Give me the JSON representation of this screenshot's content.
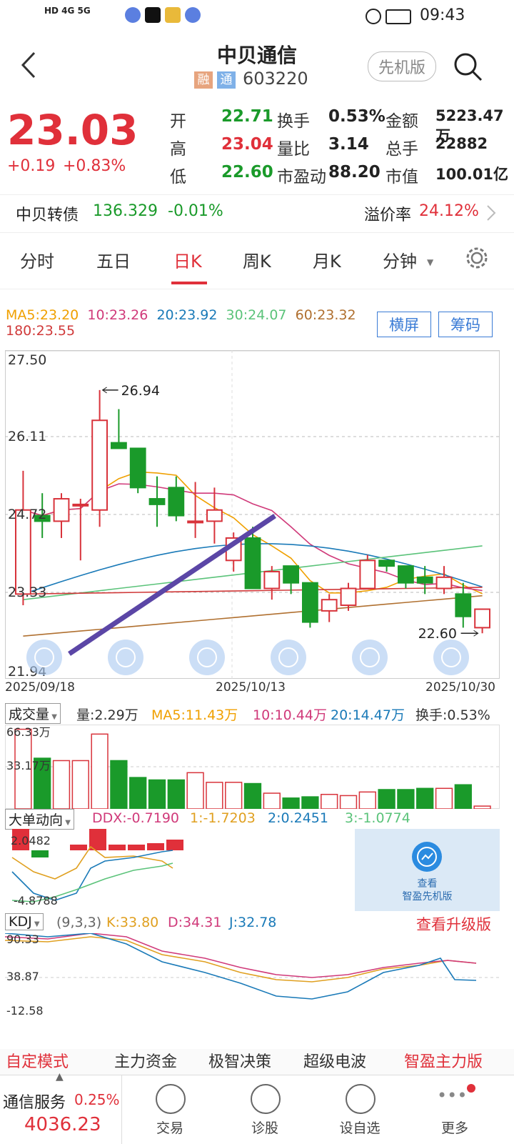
{
  "status": {
    "left": "HD 4G 5G",
    "time": "09:43"
  },
  "header": {
    "title": "中贝通信",
    "tag_rong": "融",
    "tag_tong": "通",
    "code": "603220",
    "pro_label": "先机版"
  },
  "quote": {
    "price": "23.03",
    "change": "+0.19",
    "change_pct": "+0.83%",
    "rows": [
      [
        {
          "k": "开",
          "v": "22.71",
          "c": "green"
        },
        {
          "k": "换手",
          "v": "0.53%",
          "c": "black"
        },
        {
          "k": "金额",
          "v": "5223.47万",
          "c": "black"
        }
      ],
      [
        {
          "k": "高",
          "v": "23.04",
          "c": "red"
        },
        {
          "k": "量比",
          "v": "3.14",
          "c": "black"
        },
        {
          "k": "总手",
          "v": "22882",
          "c": "black"
        }
      ],
      [
        {
          "k": "低",
          "v": "22.60",
          "c": "green"
        },
        {
          "k": "市盈动",
          "v": "88.20",
          "c": "black"
        },
        {
          "k": "市值",
          "v": "100.01亿",
          "c": "black"
        }
      ]
    ]
  },
  "bond": {
    "name": "中贝转债",
    "price": "136.329",
    "chg": "-0.01%",
    "premium_label": "溢价率",
    "premium": "24.12%"
  },
  "tabs": [
    "分时",
    "五日",
    "日K",
    "周K",
    "月K",
    "分钟"
  ],
  "active_tab": "日K",
  "ma": {
    "line1": [
      "MA5:23.20",
      "10:23.26",
      "20:23.92",
      "30:24.07",
      "60:23.32"
    ],
    "line2": "180:23.55",
    "colors": [
      "#f0a000",
      "#d03a7a",
      "#1a7ab8",
      "#5bc37a",
      "#b07030",
      "#d03a3a"
    ],
    "btn_landscape": "横屏",
    "btn_chips": "筹码"
  },
  "kline": {
    "y_labels": [
      "27.50",
      "26.11",
      "24.72",
      "23.33",
      "21.94"
    ],
    "dates": [
      "2025/09/18",
      "2025/10/13",
      "2025/10/30"
    ],
    "high_annot": "26.94",
    "low_annot": "22.60"
  },
  "volume": {
    "selector": "成交量",
    "labels": [
      "量:2.29万",
      "MA5:11.43万",
      "10:10.44万",
      "20:14.47万",
      "换手:0.53%"
    ],
    "y_labels": [
      "66.33万",
      "33.17万"
    ]
  },
  "ddx": {
    "selector": "大单动向",
    "labels": [
      "DDX:-0.7190",
      "1:-1.7203",
      "2:0.2451",
      "3:-1.0774"
    ],
    "y_labels": [
      "2.0482",
      "-4.8788"
    ],
    "promo_line1": "查看",
    "promo_line2": "智盈先机版"
  },
  "kdj": {
    "selector": "KDJ",
    "params": "(9,3,3)",
    "labels": [
      "K:33.80",
      "D:34.31",
      "J:32.78"
    ],
    "upgrade": "查看升级版",
    "y_labels": [
      "90.33",
      "38.87",
      "-12.58"
    ]
  },
  "bottom_tabs": [
    "自定模式",
    "主力资金",
    "极智决策",
    "超级电波",
    "智盈主力版"
  ],
  "sector": {
    "name": "通信服务",
    "pct": "0.25%",
    "value": "4036.23"
  },
  "bottom_nav": [
    "交易",
    "诊股",
    "设自选",
    "更多"
  ],
  "candles": [
    {
      "o": 23.3,
      "h": 25.5,
      "l": 23.1,
      "c": 24.8
    },
    {
      "o": 24.7,
      "h": 25.1,
      "l": 24.3,
      "c": 24.6
    },
    {
      "o": 24.6,
      "h": 25.1,
      "l": 24.3,
      "c": 25.0
    },
    {
      "o": 24.9,
      "h": 25.0,
      "l": 23.9,
      "c": 24.9
    },
    {
      "o": 24.8,
      "h": 26.94,
      "l": 24.5,
      "c": 26.4
    },
    {
      "o": 26.0,
      "h": 26.6,
      "l": 25.9,
      "c": 25.9
    },
    {
      "o": 25.9,
      "h": 25.9,
      "l": 25.1,
      "c": 25.2
    },
    {
      "o": 25.0,
      "h": 25.4,
      "l": 24.5,
      "c": 24.9
    },
    {
      "o": 25.2,
      "h": 25.4,
      "l": 24.6,
      "c": 24.7
    },
    {
      "o": 24.6,
      "h": 25.3,
      "l": 24.3,
      "c": 24.6
    },
    {
      "o": 24.6,
      "h": 25.2,
      "l": 24.2,
      "c": 24.8
    },
    {
      "o": 23.9,
      "h": 24.4,
      "l": 23.7,
      "c": 24.3
    },
    {
      "o": 24.3,
      "h": 24.5,
      "l": 23.5,
      "c": 23.4
    },
    {
      "o": 23.4,
      "h": 23.8,
      "l": 23.2,
      "c": 23.7
    },
    {
      "o": 23.8,
      "h": 23.8,
      "l": 23.3,
      "c": 23.5
    },
    {
      "o": 23.5,
      "h": 23.5,
      "l": 22.7,
      "c": 22.8
    },
    {
      "o": 23.0,
      "h": 23.3,
      "l": 22.8,
      "c": 23.2
    },
    {
      "o": 23.1,
      "h": 23.5,
      "l": 23.0,
      "c": 23.4
    },
    {
      "o": 23.4,
      "h": 24.0,
      "l": 23.4,
      "c": 23.9
    },
    {
      "o": 23.9,
      "h": 23.9,
      "l": 23.7,
      "c": 23.8
    },
    {
      "o": 23.8,
      "h": 23.8,
      "l": 23.4,
      "c": 23.5
    },
    {
      "o": 23.6,
      "h": 23.8,
      "l": 23.3,
      "c": 23.5
    },
    {
      "o": 23.4,
      "h": 23.8,
      "l": 23.3,
      "c": 23.6
    },
    {
      "o": 23.3,
      "h": 23.5,
      "l": 22.7,
      "c": 22.9
    },
    {
      "o": 22.7,
      "h": 23.04,
      "l": 22.6,
      "c": 23.03
    }
  ],
  "vols": [
    66,
    42,
    40,
    40,
    62,
    40,
    26,
    24,
    24,
    30,
    22,
    22,
    21,
    13,
    9,
    10,
    12,
    11,
    14,
    16,
    16,
    17,
    17,
    20,
    2.3
  ]
}
